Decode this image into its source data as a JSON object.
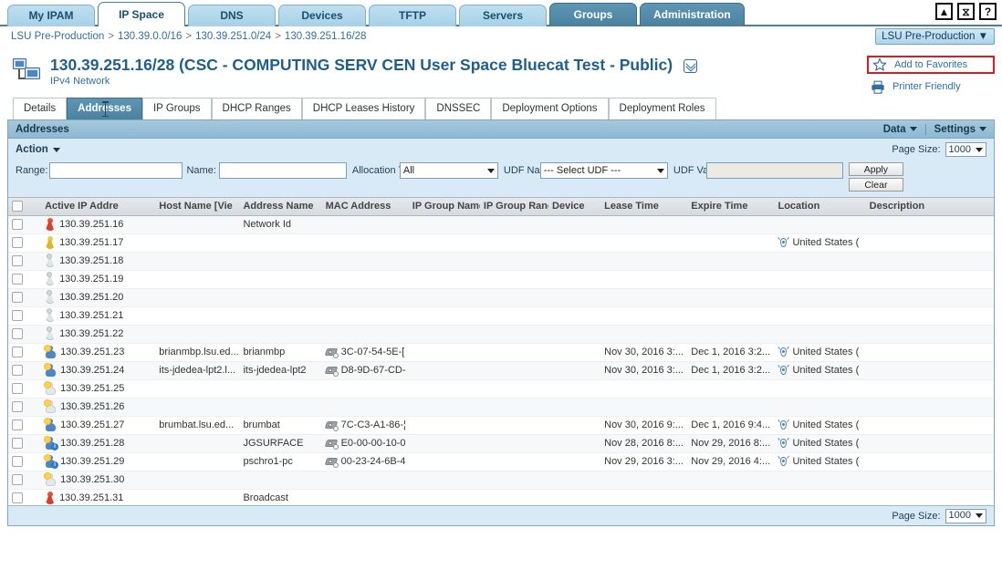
{
  "topTabs": [
    {
      "label": "My IPAM",
      "state": "normal"
    },
    {
      "label": "IP Space",
      "state": "active"
    },
    {
      "label": "DNS",
      "state": "normal"
    },
    {
      "label": "Devices",
      "state": "normal"
    },
    {
      "label": "TFTP",
      "state": "normal"
    },
    {
      "label": "Servers",
      "state": "normal"
    },
    {
      "label": "Groups",
      "state": "selected"
    },
    {
      "label": "Administration",
      "state": "selected"
    }
  ],
  "windowButtons": [
    {
      "name": "collapse-icon",
      "glyph": "▲"
    },
    {
      "name": "history-icon",
      "glyph": "⧖"
    },
    {
      "name": "help-icon",
      "glyph": "?"
    }
  ],
  "breadcrumb": {
    "items": [
      "LSU Pre-Production",
      "130.39.0.0/16",
      "130.39.251.0/24",
      "130.39.251.16/28"
    ],
    "separator": ">"
  },
  "environmentSelect": {
    "value": "LSU Pre-Production",
    "caret": "▼"
  },
  "title": {
    "main": "130.39.251.16/28 (CSC - COMPUTING SERV CEN User Space Bluecat Test - Public)",
    "sub": "IPv4 Network"
  },
  "actions": {
    "favorites_label": "Add to Favorites",
    "printer_label": "Printer Friendly"
  },
  "subTabs": [
    {
      "label": "Details",
      "active": false
    },
    {
      "label": "Addresses",
      "active": true
    },
    {
      "label": "IP Groups",
      "active": false
    },
    {
      "label": "DHCP Ranges",
      "active": false
    },
    {
      "label": "DHCP Leases History",
      "active": false
    },
    {
      "label": "DNSSEC",
      "active": false
    },
    {
      "label": "Deployment Options",
      "active": false
    },
    {
      "label": "Deployment Roles",
      "active": false
    }
  ],
  "panel": {
    "heading": "Addresses",
    "data_menu": "Data",
    "settings_menu": "Settings",
    "action_menu": "Action"
  },
  "filters": {
    "range_label": "Range:",
    "range_value": "",
    "name_label": "Name:",
    "name_value": "",
    "alloc_label": "Allocation Type:",
    "alloc_value": "All",
    "udf_name_label": "UDF Name:",
    "udf_name_value": "--- Select UDF ---",
    "udf_value_label": "UDF Value:",
    "udf_value_value": "",
    "apply_label": "Apply",
    "clear_label": "Clear",
    "page_size_label": "Page Size:",
    "page_size_value": "1000"
  },
  "table": {
    "columns": [
      "Active IP Addre",
      "Host Name [Vie",
      "Address Name",
      "MAC Address",
      "IP Group Name",
      "IP Group Range",
      "Device",
      "Lease Time",
      "Expire Time",
      "Location",
      "Description"
    ],
    "rows": [
      {
        "icon": "pin-red",
        "ip": "130.39.251.16",
        "host": "",
        "addrName": "Network Id",
        "mac": "",
        "ipGroupName": "",
        "ipGroupRange": "",
        "device": "",
        "lease": "",
        "expire": "",
        "location": "",
        "description": ""
      },
      {
        "icon": "pin-yellow",
        "ip": "130.39.251.17",
        "host": "",
        "addrName": "",
        "mac": "",
        "ipGroupName": "",
        "ipGroupRange": "",
        "device": "",
        "lease": "",
        "expire": "",
        "location": "United States (",
        "description": ""
      },
      {
        "icon": "pin-grey",
        "ip": "130.39.251.18",
        "host": "",
        "addrName": "",
        "mac": "",
        "ipGroupName": "",
        "ipGroupRange": "",
        "device": "",
        "lease": "",
        "expire": "",
        "location": "",
        "description": ""
      },
      {
        "icon": "pin-grey",
        "ip": "130.39.251.19",
        "host": "",
        "addrName": "",
        "mac": "",
        "ipGroupName": "",
        "ipGroupRange": "",
        "device": "",
        "lease": "",
        "expire": "",
        "location": "",
        "description": ""
      },
      {
        "icon": "pin-grey",
        "ip": "130.39.251.20",
        "host": "",
        "addrName": "",
        "mac": "",
        "ipGroupName": "",
        "ipGroupRange": "",
        "device": "",
        "lease": "",
        "expire": "",
        "location": "",
        "description": ""
      },
      {
        "icon": "pin-grey",
        "ip": "130.39.251.21",
        "host": "",
        "addrName": "",
        "mac": "",
        "ipGroupName": "",
        "ipGroupRange": "",
        "device": "",
        "lease": "",
        "expire": "",
        "location": "",
        "description": ""
      },
      {
        "icon": "pin-grey",
        "ip": "130.39.251.22",
        "host": "",
        "addrName": "",
        "mac": "",
        "ipGroupName": "",
        "ipGroupRange": "",
        "device": "",
        "lease": "",
        "expire": "",
        "location": "",
        "description": ""
      },
      {
        "icon": "person-sun",
        "ip": "130.39.251.23",
        "host": "brianmbp.lsu.ed...",
        "addrName": "brianmbp",
        "mac": "3C-07-54-5E-[",
        "ipGroupName": "",
        "ipGroupRange": "",
        "device": "",
        "lease": "Nov 30, 2016 3:...",
        "expire": "Dec 1, 2016 3:2...",
        "location": "United States (",
        "description": ""
      },
      {
        "icon": "person-sun",
        "ip": "130.39.251.24",
        "host": "its-jdedea-lpt2.l...",
        "addrName": "its-jdedea-lpt2",
        "mac": "D8-9D-67-CD-",
        "ipGroupName": "",
        "ipGroupRange": "",
        "device": "",
        "lease": "Nov 30, 2016 3:...",
        "expire": "Dec 1, 2016 3:2...",
        "location": "United States (",
        "description": ""
      },
      {
        "icon": "person-ghost-sun",
        "ip": "130.39.251.25",
        "host": "",
        "addrName": "",
        "mac": "",
        "ipGroupName": "",
        "ipGroupRange": "",
        "device": "",
        "lease": "",
        "expire": "",
        "location": "",
        "description": ""
      },
      {
        "icon": "person-ghost-sun",
        "ip": "130.39.251.26",
        "host": "",
        "addrName": "",
        "mac": "",
        "ipGroupName": "",
        "ipGroupRange": "",
        "device": "",
        "lease": "",
        "expire": "",
        "location": "",
        "description": ""
      },
      {
        "icon": "person-sun",
        "ip": "130.39.251.27",
        "host": "brumbat.lsu.ed...",
        "addrName": "brumbat",
        "mac": "7C-C3-A1-86-¦",
        "ipGroupName": "",
        "ipGroupRange": "",
        "device": "",
        "lease": "Nov 30, 2016 9:...",
        "expire": "Dec 1, 2016 9:4...",
        "location": "United States (",
        "description": ""
      },
      {
        "icon": "person-sun-info",
        "ip": "130.39.251.28",
        "host": "",
        "addrName": "JGSURFACE",
        "mac": "E0-00-00-10-0",
        "ipGroupName": "",
        "ipGroupRange": "",
        "device": "",
        "lease": "Nov 28, 2016 8:...",
        "expire": "Nov 29, 2016 8:...",
        "location": "United States (",
        "description": ""
      },
      {
        "icon": "person-sun-info",
        "ip": "130.39.251.29",
        "host": "",
        "addrName": "pschro1-pc",
        "mac": "00-23-24-6B-4",
        "ipGroupName": "",
        "ipGroupRange": "",
        "device": "",
        "lease": "Nov 29, 2016 3:...",
        "expire": "Nov 29, 2016 4:...",
        "location": "United States (",
        "description": ""
      },
      {
        "icon": "person-ghost-sun",
        "ip": "130.39.251.30",
        "host": "",
        "addrName": "",
        "mac": "",
        "ipGroupName": "",
        "ipGroupRange": "",
        "device": "",
        "lease": "",
        "expire": "",
        "location": "",
        "description": ""
      },
      {
        "icon": "pin-red",
        "ip": "130.39.251.31",
        "host": "",
        "addrName": "Broadcast",
        "mac": "",
        "ipGroupName": "",
        "ipGroupRange": "",
        "device": "",
        "lease": "",
        "expire": "",
        "location": "",
        "description": ""
      }
    ]
  },
  "footer": {
    "page_size_label": "Page Size:",
    "page_size_value": "1000"
  },
  "colors": {
    "accent": "#1f5f8b",
    "tabSelected": "#4a819f",
    "highlight": "#e01b1b",
    "panelHead": "#8eb9d1",
    "filterBg": "#d9eaf7"
  }
}
